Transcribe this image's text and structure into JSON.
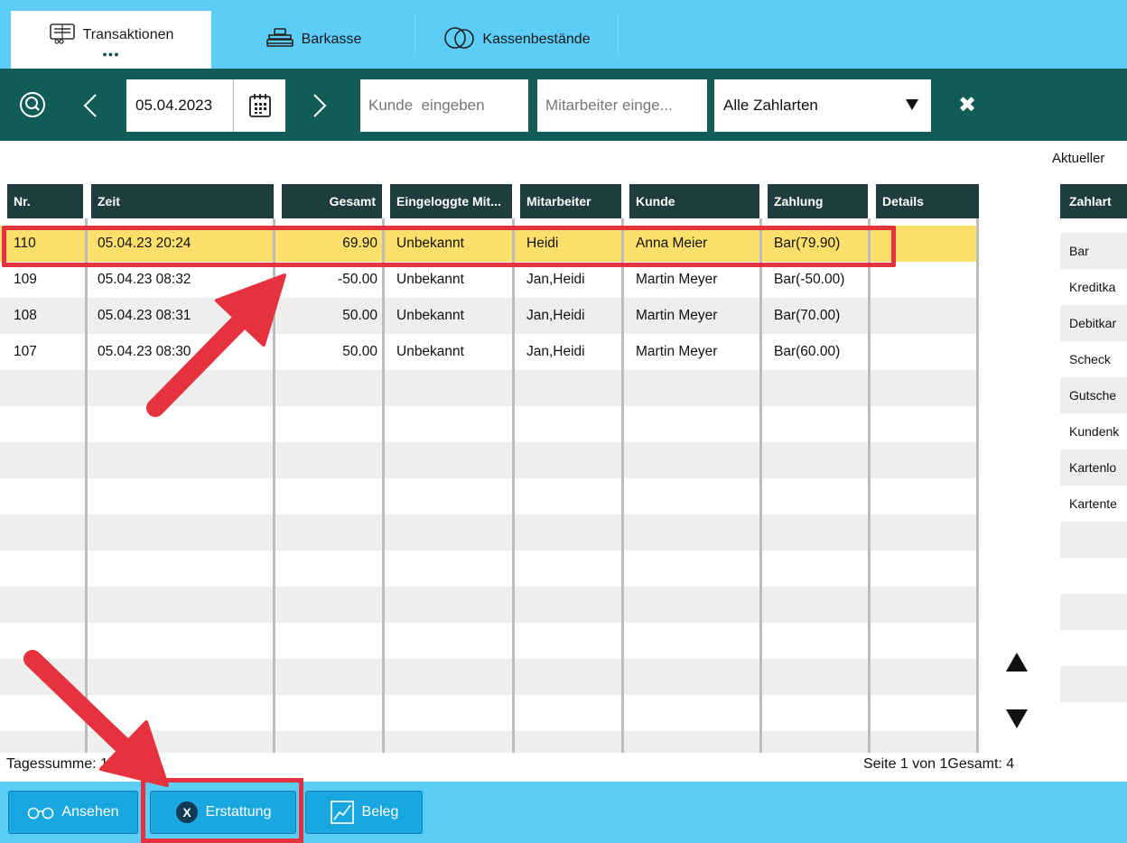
{
  "tabs": [
    {
      "label": "Transaktionen",
      "icon": "receipt-icon",
      "active": true
    },
    {
      "label": "Barkasse",
      "icon": "cash-register-icon",
      "active": false
    },
    {
      "label": "Kassenbestände",
      "icon": "coins-icon",
      "active": false
    }
  ],
  "active_tab_dots": "●●●",
  "filter": {
    "date": "05.04.2023",
    "customer_placeholder": "Kunde  eingeben",
    "employee_placeholder": "Mitarbeiter einge...",
    "payment_select": "Alle Zahlarten",
    "close_label": "✖"
  },
  "aktueller_label": "Aktueller",
  "table": {
    "headers": [
      "Nr.",
      "Zeit",
      "Gesamt",
      "Eingeloggte Mit...",
      "Mitarbeiter",
      "Kunde",
      "Zahlung",
      "Details"
    ],
    "rows": [
      {
        "nr": "110",
        "zeit": "05.04.23 20:24",
        "gesamt": "69.90",
        "eingeloggt": "Unbekannt",
        "mitarbeiter": "Heidi",
        "kunde": "Anna Meier",
        "zahlung": "Bar(79.90)",
        "details": ""
      },
      {
        "nr": "109",
        "zeit": "05.04.23 08:32",
        "gesamt": "-50.00",
        "eingeloggt": "Unbekannt",
        "mitarbeiter": "Jan,Heidi",
        "kunde": "Martin Meyer",
        "zahlung": "Bar(-50.00)",
        "details": ""
      },
      {
        "nr": "108",
        "zeit": "05.04.23 08:31",
        "gesamt": "50.00",
        "eingeloggt": "Unbekannt",
        "mitarbeiter": "Jan,Heidi",
        "kunde": "Martin Meyer",
        "zahlung": "Bar(70.00)",
        "details": ""
      },
      {
        "nr": "107",
        "zeit": "05.04.23 08:30",
        "gesamt": "50.00",
        "eingeloggt": "Unbekannt",
        "mitarbeiter": "Jan,Heidi",
        "kunde": "Martin Meyer",
        "zahlung": "Bar(60.00)",
        "details": ""
      }
    ],
    "selected_row": 0
  },
  "summary": {
    "header": "Zahlart",
    "items": [
      "Bar",
      "Kreditka",
      "Debitkar",
      "Scheck",
      "Gutsche",
      "Kundenk",
      "Kartenlo",
      "Kartente"
    ]
  },
  "footer": {
    "tagessumme": "Tagessumme: 119.90",
    "pagination": "Seite 1 von 1Gesamt: 4"
  },
  "buttons": [
    {
      "label": "Ansehen",
      "icon": "glasses-icon"
    },
    {
      "label": "Erstattung",
      "icon": "x-circle-icon"
    },
    {
      "label": "Beleg",
      "icon": "chart-icon"
    }
  ],
  "colors": {
    "tabbar": "#5bcdf7",
    "filterbar": "#125c57",
    "header": "#1f3c3e",
    "selected_row": "#fde06b",
    "annotation": "#e5323e",
    "button": "#19a7e0"
  }
}
